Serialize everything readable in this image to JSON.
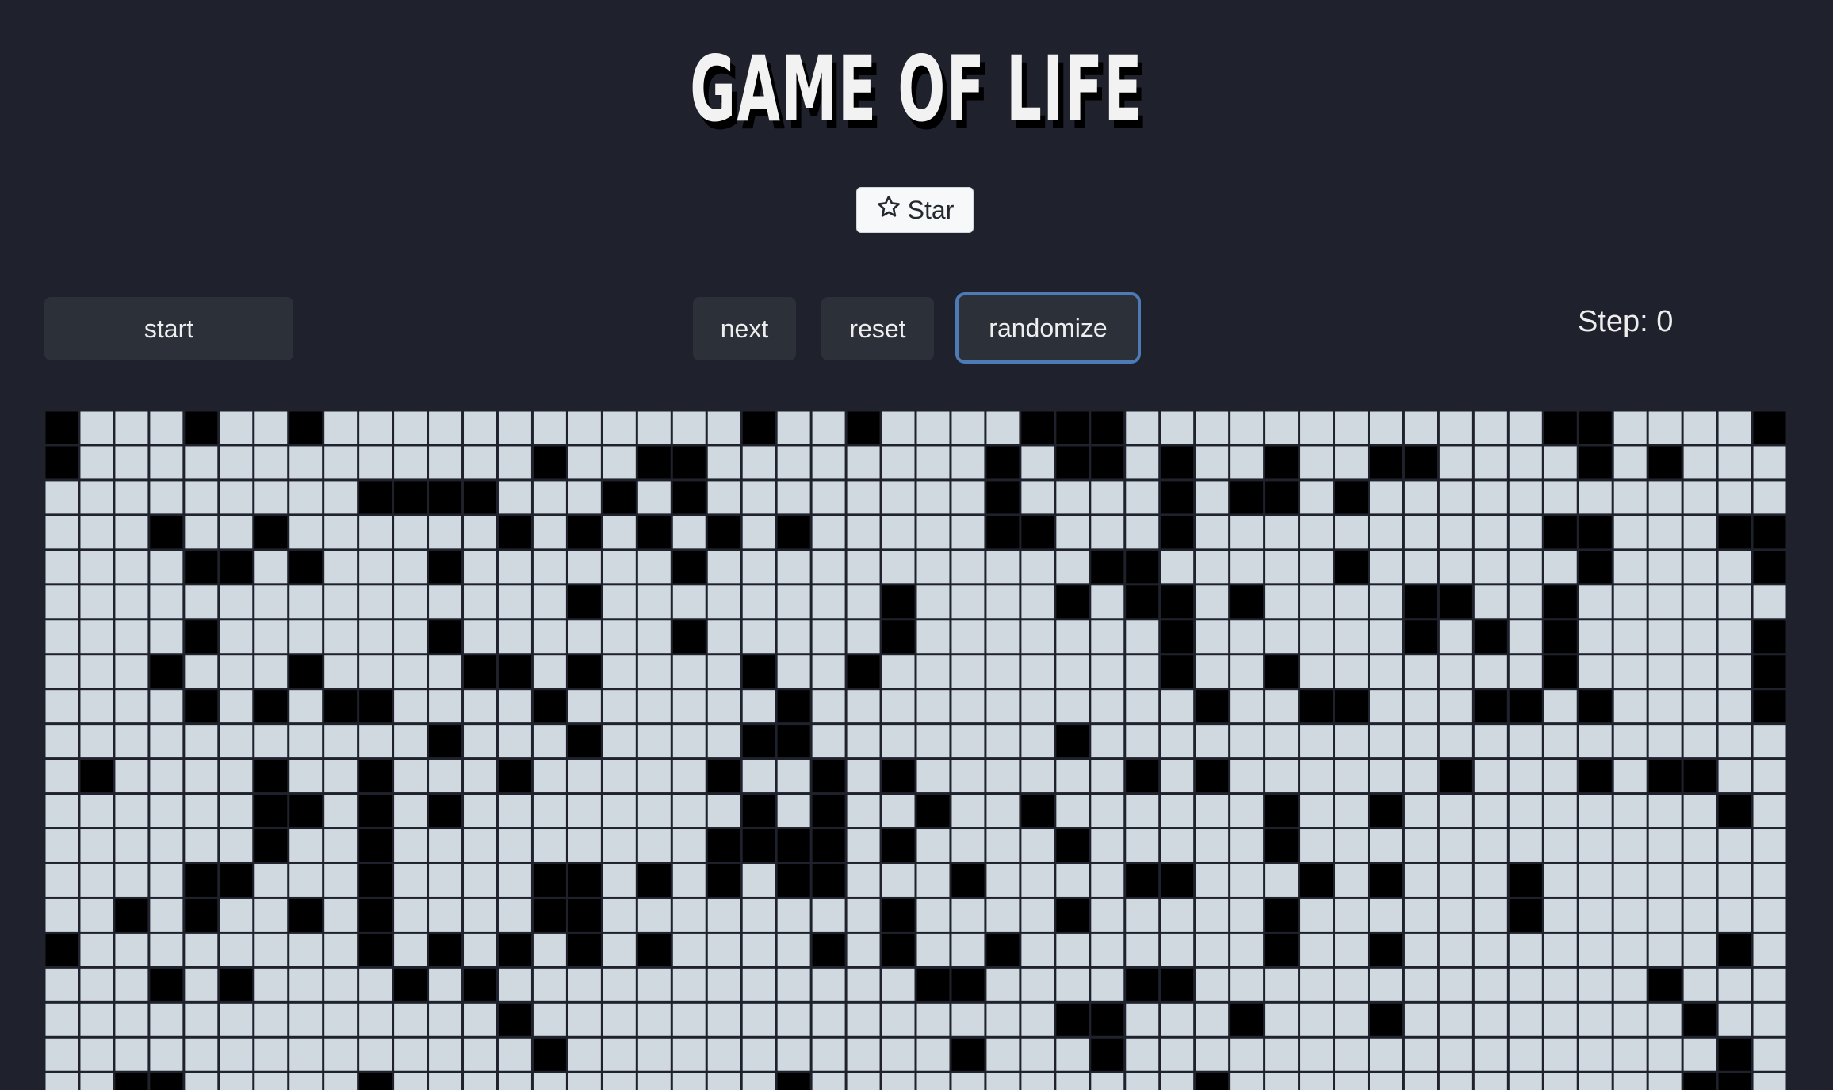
{
  "title": "GAME OF LIFE",
  "star_button": {
    "label": "Star",
    "icon": "star-outline-icon"
  },
  "controls": {
    "start_label": "start",
    "next_label": "next",
    "reset_label": "reset",
    "randomize_label": "randomize"
  },
  "step": {
    "label": "Step: 0",
    "value": 0
  },
  "colors": {
    "background": "#1f222c",
    "dead_cell": "#d0d8e0",
    "alive_cell": "#000000",
    "focus_border": "#4d7bb5"
  },
  "board": {
    "columns": 50,
    "visible_rows": 20,
    "alive_cells": [
      [
        0,
        0
      ],
      [
        0,
        4
      ],
      [
        0,
        7
      ],
      [
        0,
        20
      ],
      [
        0,
        23
      ],
      [
        0,
        28
      ],
      [
        0,
        29
      ],
      [
        0,
        30
      ],
      [
        0,
        43
      ],
      [
        0,
        44
      ],
      [
        0,
        49
      ],
      [
        1,
        0
      ],
      [
        1,
        14
      ],
      [
        1,
        17
      ],
      [
        1,
        18
      ],
      [
        1,
        27
      ],
      [
        1,
        29
      ],
      [
        1,
        30
      ],
      [
        1,
        32
      ],
      [
        1,
        35
      ],
      [
        1,
        38
      ],
      [
        1,
        39
      ],
      [
        1,
        44
      ],
      [
        1,
        46
      ],
      [
        2,
        9
      ],
      [
        2,
        10
      ],
      [
        2,
        11
      ],
      [
        2,
        12
      ],
      [
        2,
        16
      ],
      [
        2,
        18
      ],
      [
        2,
        27
      ],
      [
        2,
        32
      ],
      [
        2,
        34
      ],
      [
        2,
        35
      ],
      [
        2,
        37
      ],
      [
        3,
        3
      ],
      [
        3,
        6
      ],
      [
        3,
        13
      ],
      [
        3,
        15
      ],
      [
        3,
        17
      ],
      [
        3,
        19
      ],
      [
        3,
        21
      ],
      [
        3,
        27
      ],
      [
        3,
        28
      ],
      [
        3,
        32
      ],
      [
        3,
        43
      ],
      [
        3,
        44
      ],
      [
        3,
        48
      ],
      [
        3,
        49
      ],
      [
        4,
        4
      ],
      [
        4,
        5
      ],
      [
        4,
        7
      ],
      [
        4,
        11
      ],
      [
        4,
        18
      ],
      [
        4,
        30
      ],
      [
        4,
        31
      ],
      [
        4,
        37
      ],
      [
        4,
        44
      ],
      [
        4,
        49
      ],
      [
        5,
        15
      ],
      [
        5,
        24
      ],
      [
        5,
        29
      ],
      [
        5,
        31
      ],
      [
        5,
        32
      ],
      [
        5,
        34
      ],
      [
        5,
        39
      ],
      [
        5,
        40
      ],
      [
        5,
        43
      ],
      [
        6,
        4
      ],
      [
        6,
        11
      ],
      [
        6,
        18
      ],
      [
        6,
        24
      ],
      [
        6,
        32
      ],
      [
        6,
        39
      ],
      [
        6,
        41
      ],
      [
        6,
        43
      ],
      [
        6,
        49
      ],
      [
        7,
        3
      ],
      [
        7,
        7
      ],
      [
        7,
        12
      ],
      [
        7,
        13
      ],
      [
        7,
        15
      ],
      [
        7,
        20
      ],
      [
        7,
        23
      ],
      [
        7,
        32
      ],
      [
        7,
        35
      ],
      [
        7,
        43
      ],
      [
        7,
        49
      ],
      [
        8,
        4
      ],
      [
        8,
        6
      ],
      [
        8,
        8
      ],
      [
        8,
        9
      ],
      [
        8,
        14
      ],
      [
        8,
        21
      ],
      [
        8,
        33
      ],
      [
        8,
        36
      ],
      [
        8,
        37
      ],
      [
        8,
        41
      ],
      [
        8,
        42
      ],
      [
        8,
        44
      ],
      [
        8,
        49
      ],
      [
        9,
        11
      ],
      [
        9,
        15
      ],
      [
        9,
        20
      ],
      [
        9,
        21
      ],
      [
        9,
        29
      ],
      [
        10,
        1
      ],
      [
        10,
        6
      ],
      [
        10,
        9
      ],
      [
        10,
        13
      ],
      [
        10,
        19
      ],
      [
        10,
        22
      ],
      [
        10,
        24
      ],
      [
        10,
        31
      ],
      [
        10,
        33
      ],
      [
        10,
        40
      ],
      [
        10,
        44
      ],
      [
        10,
        46
      ],
      [
        10,
        47
      ],
      [
        11,
        6
      ],
      [
        11,
        7
      ],
      [
        11,
        9
      ],
      [
        11,
        11
      ],
      [
        11,
        20
      ],
      [
        11,
        22
      ],
      [
        11,
        25
      ],
      [
        11,
        28
      ],
      [
        11,
        35
      ],
      [
        11,
        38
      ],
      [
        11,
        48
      ],
      [
        12,
        6
      ],
      [
        12,
        9
      ],
      [
        12,
        19
      ],
      [
        12,
        20
      ],
      [
        12,
        21
      ],
      [
        12,
        22
      ],
      [
        12,
        24
      ],
      [
        12,
        29
      ],
      [
        12,
        35
      ],
      [
        13,
        4
      ],
      [
        13,
        5
      ],
      [
        13,
        9
      ],
      [
        13,
        14
      ],
      [
        13,
        15
      ],
      [
        13,
        17
      ],
      [
        13,
        19
      ],
      [
        13,
        21
      ],
      [
        13,
        22
      ],
      [
        13,
        26
      ],
      [
        13,
        31
      ],
      [
        13,
        32
      ],
      [
        13,
        36
      ],
      [
        13,
        38
      ],
      [
        13,
        42
      ],
      [
        14,
        2
      ],
      [
        14,
        4
      ],
      [
        14,
        7
      ],
      [
        14,
        9
      ],
      [
        14,
        14
      ],
      [
        14,
        15
      ],
      [
        14,
        24
      ],
      [
        14,
        29
      ],
      [
        14,
        35
      ],
      [
        14,
        42
      ],
      [
        15,
        0
      ],
      [
        15,
        9
      ],
      [
        15,
        11
      ],
      [
        15,
        13
      ],
      [
        15,
        15
      ],
      [
        15,
        17
      ],
      [
        15,
        22
      ],
      [
        15,
        24
      ],
      [
        15,
        27
      ],
      [
        15,
        35
      ],
      [
        15,
        38
      ],
      [
        15,
        48
      ],
      [
        16,
        3
      ],
      [
        16,
        5
      ],
      [
        16,
        10
      ],
      [
        16,
        12
      ],
      [
        16,
        25
      ],
      [
        16,
        26
      ],
      [
        16,
        31
      ],
      [
        16,
        32
      ],
      [
        16,
        46
      ],
      [
        17,
        13
      ],
      [
        17,
        29
      ],
      [
        17,
        30
      ],
      [
        17,
        34
      ],
      [
        17,
        38
      ],
      [
        17,
        47
      ],
      [
        18,
        14
      ],
      [
        18,
        26
      ],
      [
        18,
        30
      ],
      [
        18,
        48
      ],
      [
        19,
        2
      ],
      [
        19,
        3
      ],
      [
        19,
        9
      ],
      [
        19,
        21
      ],
      [
        19,
        33
      ],
      [
        19,
        47
      ],
      [
        19,
        48
      ]
    ]
  }
}
